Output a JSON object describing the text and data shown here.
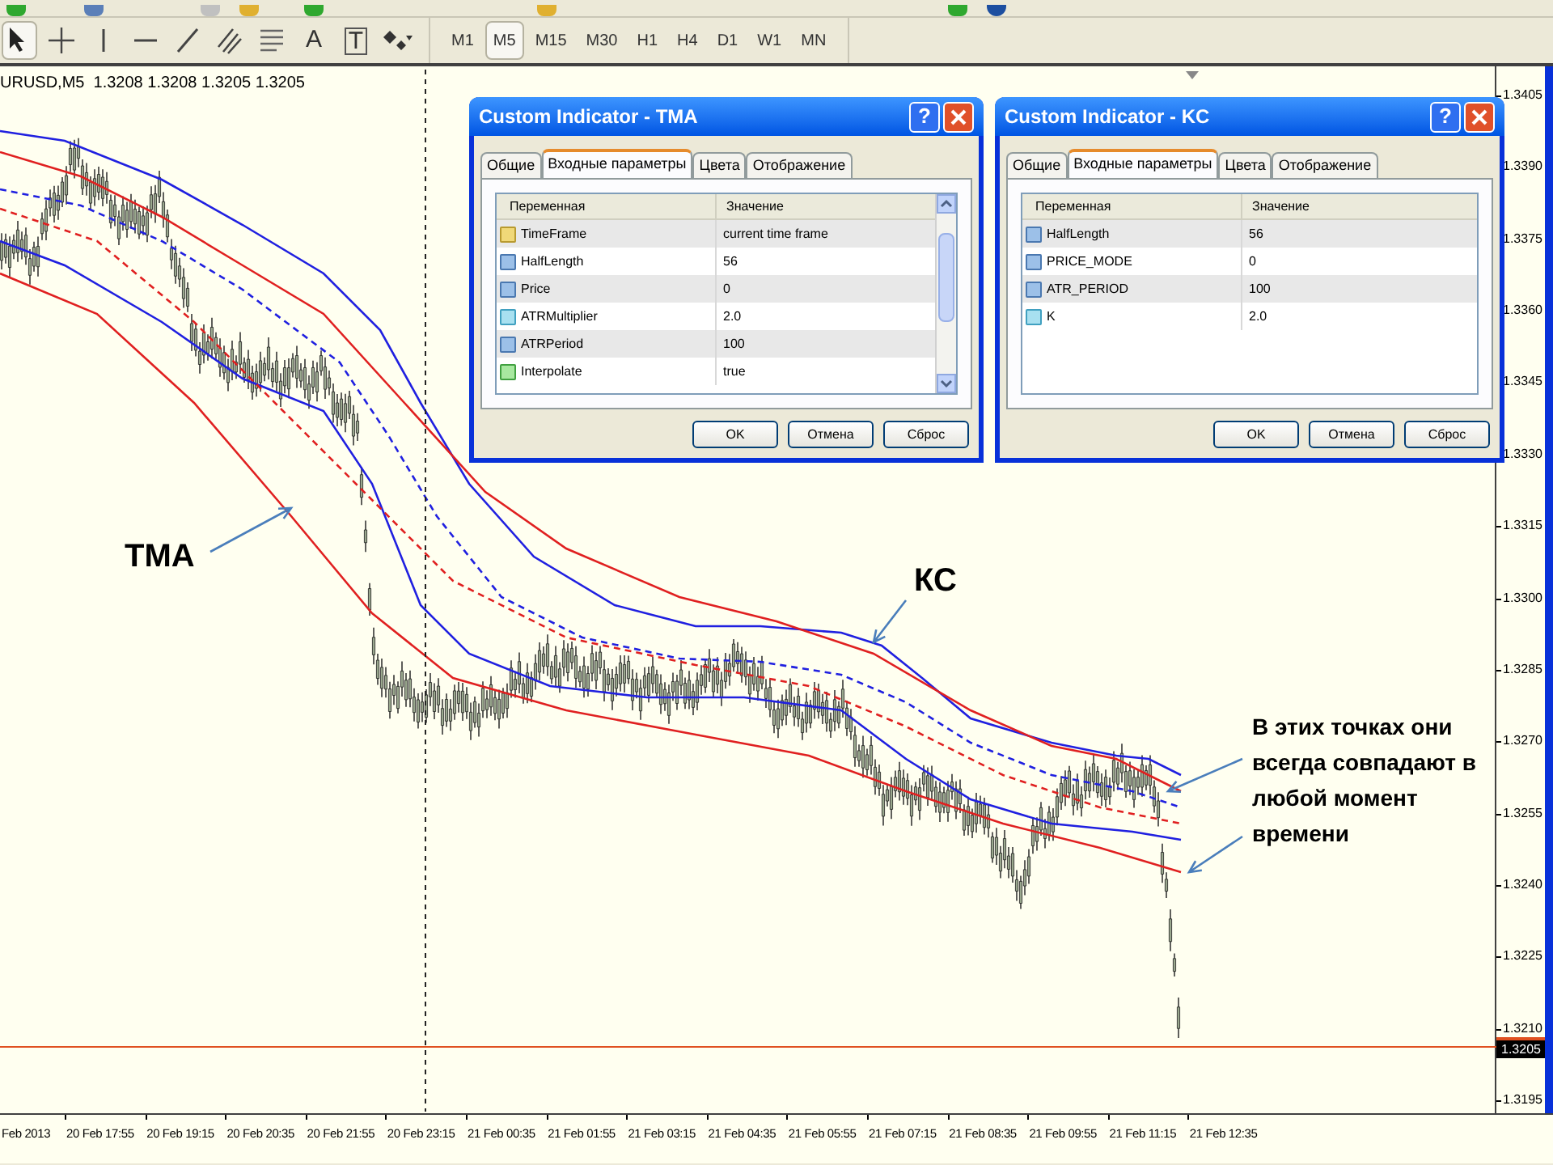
{
  "tools": [
    {
      "kind": "cursor",
      "selected": true
    },
    {
      "kind": "crosshair",
      "selected": false
    },
    {
      "kind": "vline",
      "selected": false
    },
    {
      "kind": "hline",
      "selected": false
    },
    {
      "kind": "trendline",
      "selected": false
    },
    {
      "kind": "channel",
      "selected": false
    },
    {
      "kind": "fibo",
      "selected": false
    },
    {
      "kind": "text",
      "label": "A",
      "selected": false
    },
    {
      "kind": "label",
      "label": "T",
      "selected": false
    },
    {
      "kind": "shapes",
      "selected": false
    }
  ],
  "timeframes": [
    {
      "label": "M1",
      "selected": false
    },
    {
      "label": "M5",
      "selected": true
    },
    {
      "label": "M15",
      "selected": false
    },
    {
      "label": "M30",
      "selected": false
    },
    {
      "label": "H1",
      "selected": false
    },
    {
      "label": "H4",
      "selected": false
    },
    {
      "label": "D1",
      "selected": false
    },
    {
      "label": "W1",
      "selected": false
    },
    {
      "label": "MN",
      "selected": false
    }
  ],
  "chart": {
    "header": "URUSD,M5  1.3208 1.3208 1.3205 1.3205",
    "price_axis": [
      "1.3405",
      "1.3390",
      "1.3375",
      "1.3360",
      "1.3345",
      "1.3330",
      "1.3315",
      "1.3300",
      "1.3285",
      "1.3270",
      "1.3255",
      "1.3240",
      "1.3225",
      "1.3210",
      "1.3195"
    ],
    "current_price": "1.3205",
    "time_axis": [
      "Feb 2013",
      "20 Feb 17:55",
      "20 Feb 19:15",
      "20 Feb 20:35",
      "20 Feb 21:55",
      "20 Feb 23:15",
      "21 Feb 00:35",
      "21 Feb 01:55",
      "21 Feb 03:15",
      "21 Feb 04:35",
      "21 Feb 05:55",
      "21 Feb 07:15",
      "21 Feb 08:35",
      "21 Feb 09:55",
      "21 Feb 11:15",
      "21 Feb 12:35"
    ],
    "annotations": [
      {
        "kind": "tma",
        "text": "TMA"
      },
      {
        "kind": "kc",
        "text": "КС"
      },
      {
        "kind": "note",
        "text": "В этих точках они всегда совпадают в любой момент времени"
      }
    ]
  },
  "dialogs": [
    {
      "title": "Custom Indicator - TMA",
      "help": "?",
      "scrollbar": true,
      "tabs": [
        {
          "label": "Общие",
          "selected": false
        },
        {
          "label": "Входные параметры",
          "selected": true
        },
        {
          "label": "Цвета",
          "selected": false
        },
        {
          "label": "Отображение",
          "selected": false
        }
      ],
      "columns": [
        "Переменная",
        "Значение"
      ],
      "rows": [
        {
          "kind": "string",
          "name": "TimeFrame",
          "value": "current time frame"
        },
        {
          "kind": "int",
          "name": "HalfLength",
          "value": "56"
        },
        {
          "kind": "int",
          "name": "Price",
          "value": "0"
        },
        {
          "kind": "double",
          "name": "ATRMultiplier",
          "value": "2.0"
        },
        {
          "kind": "int",
          "name": "ATRPeriod",
          "value": "100"
        },
        {
          "kind": "bool",
          "name": "Interpolate",
          "value": "true"
        }
      ],
      "buttons": [
        "OK",
        "Отмена",
        "Сброс"
      ]
    },
    {
      "title": "Custom Indicator - KC",
      "help": "?",
      "scrollbar": false,
      "tabs": [
        {
          "label": "Общие",
          "selected": false
        },
        {
          "label": "Входные параметры",
          "selected": true
        },
        {
          "label": "Цвета",
          "selected": false
        },
        {
          "label": "Отображение",
          "selected": false
        }
      ],
      "columns": [
        "Переменная",
        "Значение"
      ],
      "rows": [
        {
          "kind": "int",
          "name": "HalfLength",
          "value": "56"
        },
        {
          "kind": "int",
          "name": "PRICE_MODE",
          "value": "0"
        },
        {
          "kind": "int",
          "name": "ATR_PERIOD",
          "value": "100"
        },
        {
          "kind": "double",
          "name": "K",
          "value": "2.0"
        }
      ],
      "buttons": [
        "OK",
        "Отмена",
        "Сброс"
      ]
    }
  ]
}
